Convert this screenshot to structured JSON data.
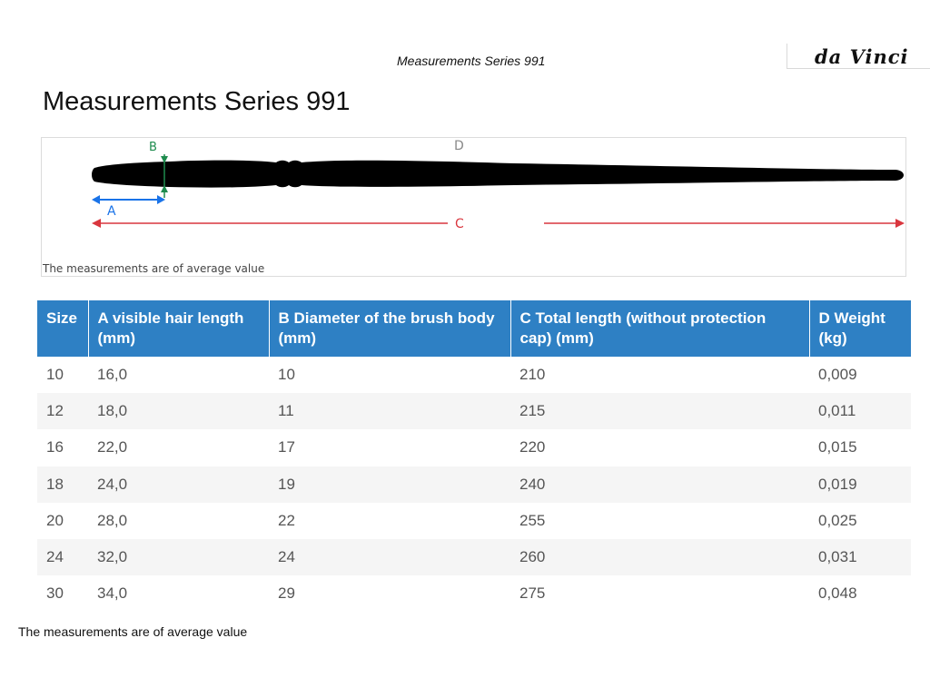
{
  "header": {
    "title": "Measurements Series 991",
    "logo_text": "da Vinci"
  },
  "page_title": "Measurements Series 991",
  "diagram": {
    "labels": {
      "a": "A",
      "b": "B",
      "c": "C",
      "d": "D"
    },
    "note": "The measurements are of average value",
    "colors": {
      "a": "#1a73e8",
      "b": "#1e8c4e",
      "c": "#d9363e",
      "d": "#888888",
      "brush": "#000000"
    }
  },
  "table": {
    "columns": [
      "Size",
      "A visible hair length (mm)",
      "B Diameter of the brush body (mm)",
      "C Total length (without protection cap) (mm)",
      "D Weight (kg)"
    ],
    "rows": [
      [
        "10",
        "16,0",
        "10",
        "210",
        "0,009"
      ],
      [
        "12",
        "18,0",
        "11",
        "215",
        "0,011"
      ],
      [
        "16",
        "22,0",
        "17",
        "220",
        "0,015"
      ],
      [
        "18",
        "24,0",
        "19",
        "240",
        "0,019"
      ],
      [
        "20",
        "28,0",
        "22",
        "255",
        "0,025"
      ],
      [
        "24",
        "32,0",
        "24",
        "260",
        "0,031"
      ],
      [
        "30",
        "34,0",
        "29",
        "275",
        "0,048"
      ]
    ],
    "header_color": "#2e80c4"
  },
  "footer_note": "The measurements are of average value"
}
